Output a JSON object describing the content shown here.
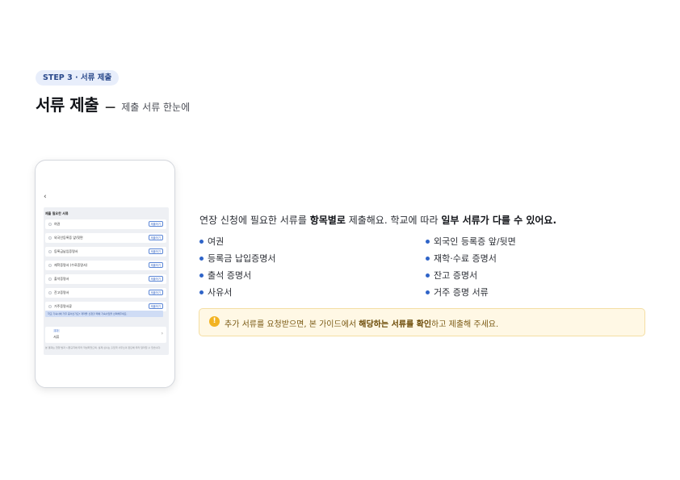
{
  "header": {
    "step_badge": "STEP 3 · 서류 제출",
    "title": "서류 제출",
    "dash": "—",
    "subtitle": "제출 서류 한눈에"
  },
  "phone": {
    "back_icon": "chevron-left-icon",
    "panel_title": "제출 필요한 서류",
    "button_label": "제출하기",
    "documents": [
      "여권",
      "외국인등록증 앞/뒷면",
      "등록금납입증명서",
      "재학증명서 (수료증명서)",
      "출석증명서",
      "잔고증명서",
      "거주증명서류"
    ],
    "hint": "학교 기숙사에 거주 중이신가요? 계약을 신청할 때에 기숙사입을 선택해주세요.",
    "card_tag": "추가",
    "card_name": "서류",
    "note": "본 결과는 현행 법과 시행규칙에 따라 작성되었으며, 실제 심사는 출입국 사무소의 판단에 따라 달라질 수 있습니다."
  },
  "intro": {
    "part1": "연장 신청에 필요한 서류를 ",
    "bold1": "항목별로",
    "part2": " 제출해요. 학교에 따라 ",
    "bold2": "일부 서류가 다를 수 있어요."
  },
  "documents": {
    "left": [
      "여권",
      "등록금 납입증명서",
      "출석 증명서",
      "사유서"
    ],
    "right": [
      "외국인 등록증 앞/뒷면",
      "재학·수료 증명서",
      "잔고 증명서",
      "거주 증명 서류"
    ]
  },
  "notice": {
    "icon": "!",
    "part1": "추가 서류를 요청받으면, 본 가이드에서 ",
    "bold": "해당하는 서류를 확인",
    "part2": "하고 제출해 주세요."
  },
  "colors": {
    "accent": "#2f64c8",
    "badge_bg": "#e8eefb",
    "notice_bg": "#fff8e5",
    "notice_icon": "#f2b322"
  }
}
